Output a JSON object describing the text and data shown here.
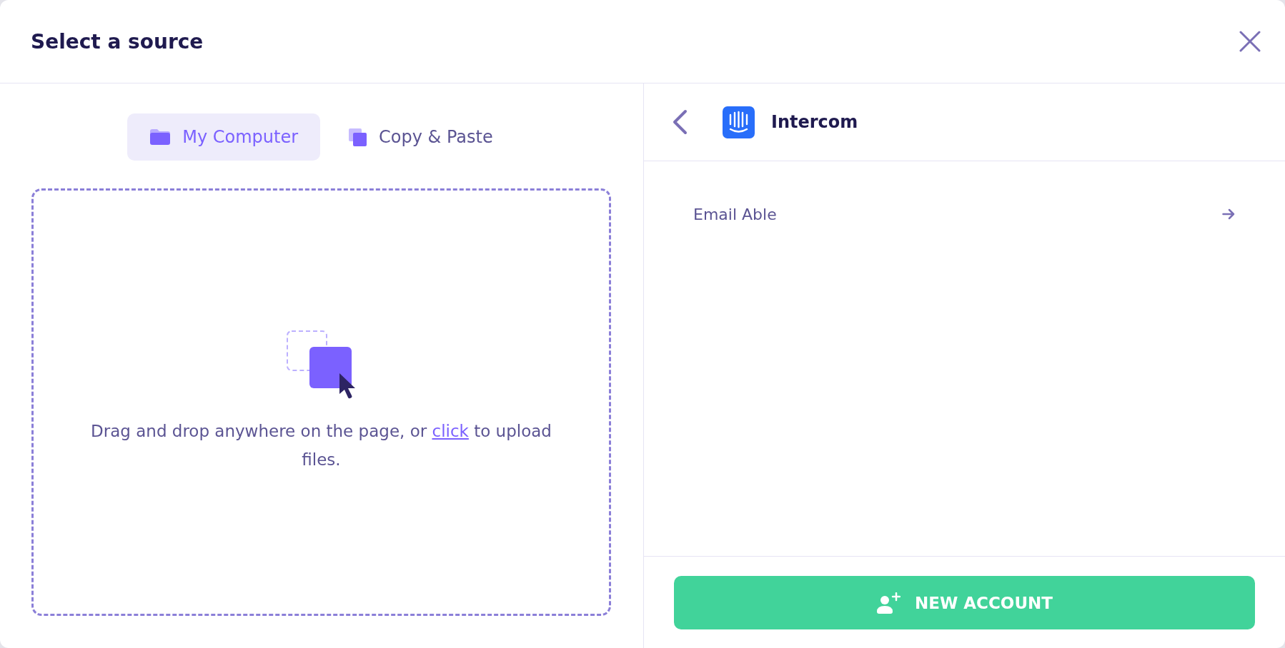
{
  "dialog": {
    "title": "Select a source"
  },
  "source_tabs": [
    {
      "kind": "folder",
      "label": "My Computer",
      "selected": true
    },
    {
      "kind": "copy",
      "label": "Copy & Paste",
      "selected": false
    }
  ],
  "drop_zone": {
    "text_before": "Drag and drop anywhere on the page, or",
    "link": "click",
    "text_after": "to upload files."
  },
  "integration": {
    "name": "Intercom"
  },
  "accounts": [
    {
      "name": "Email Able"
    }
  ],
  "new_account_button": {
    "label": "NEW ACCOUNT"
  }
}
